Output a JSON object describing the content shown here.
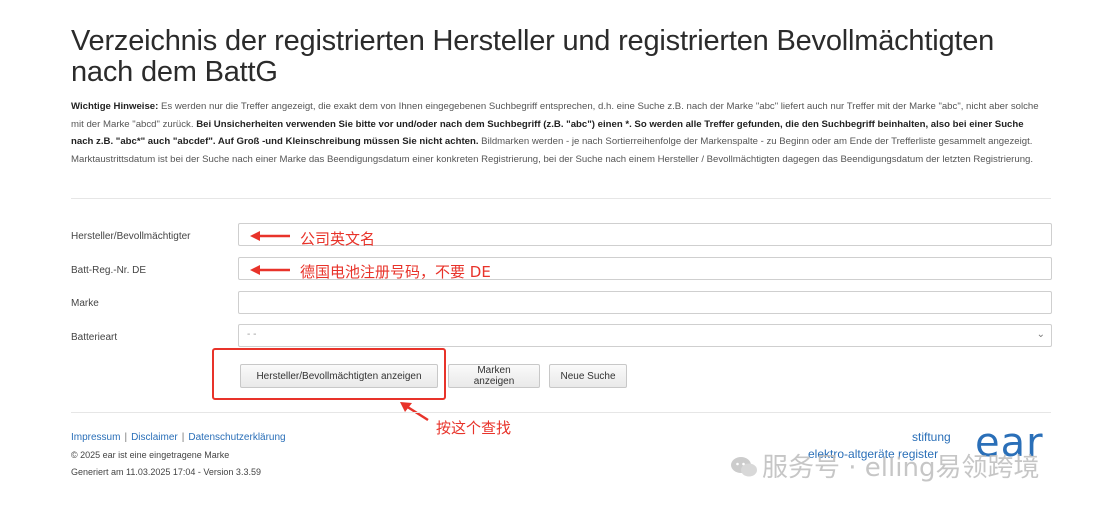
{
  "page": {
    "title": "Verzeichnis der registrierten Hersteller und registrierten Bevollmächtigten nach dem BattG",
    "notice": {
      "lead": "Wichtige Hinweise:",
      "text1": " Es werden nur die Treffer angezeigt, die exakt dem von Ihnen eingegebenen Suchbegriff entsprechen, d.h. eine Suche z.B. nach der Marke \"abc\" liefert auch nur Treffer mit der Marke \"abc\", nicht aber solche mit der Marke \"abcd\" zurück. ",
      "bold": "Bei Unsicherheiten verwenden Sie bitte vor und/oder nach dem Suchbegriff (z.B. \"abc\") einen *. So werden alle Treffer gefunden, die den Suchbegriff beinhalten, also bei einer Suche nach z.B. \"abc*\" auch \"abcdef\". Auf Groß -und Kleinschreibung müssen Sie nicht achten.",
      "text2": " Bildmarken werden - je nach Sortierreihenfolge der Markenspalte - zu Beginn oder am Ende der Trefferliste gesammelt angezeigt. Marktaustrittsdatum ist bei der Suche nach einer Marke das Beendigungsdatum einer konkreten Registrierung, bei der Suche nach einem Hersteller / Bevollmächtigten dagegen das Beendigungsdatum der letzten Registrierung."
    }
  },
  "form": {
    "fields": [
      {
        "label": "Hersteller/Bevollmächtigter",
        "value": ""
      },
      {
        "label": "Batt-Reg.-Nr. DE",
        "value": ""
      },
      {
        "label": "Marke",
        "value": ""
      }
    ],
    "select": {
      "label": "Batterieart",
      "value": "- -"
    },
    "buttons": {
      "show_manufacturers": "Hersteller/Bevollmächtigten anzeigen",
      "show_brands": "Marken anzeigen",
      "new_search": "Neue Suche"
    }
  },
  "annotations": {
    "company_name": "公司英文名",
    "battery_reg": "德国电池注册号码，不要 DE",
    "click_search": "按这个查找",
    "color": "#e8332a"
  },
  "footer": {
    "links": [
      "Impressum",
      "Disclaimer",
      "Datenschutzerklärung"
    ],
    "trademark": "© 2025 ear ist eine eingetragene Marke",
    "generated": "Generiert am 11.03.2025 17:04 - Version 3.3.59"
  },
  "logo": {
    "line1": "stiftung",
    "line2": "elektro-altgeräte register",
    "mark": "ear",
    "color": "#2a6fb8"
  },
  "watermark": {
    "text": "服务号 · elling易领跨境"
  }
}
